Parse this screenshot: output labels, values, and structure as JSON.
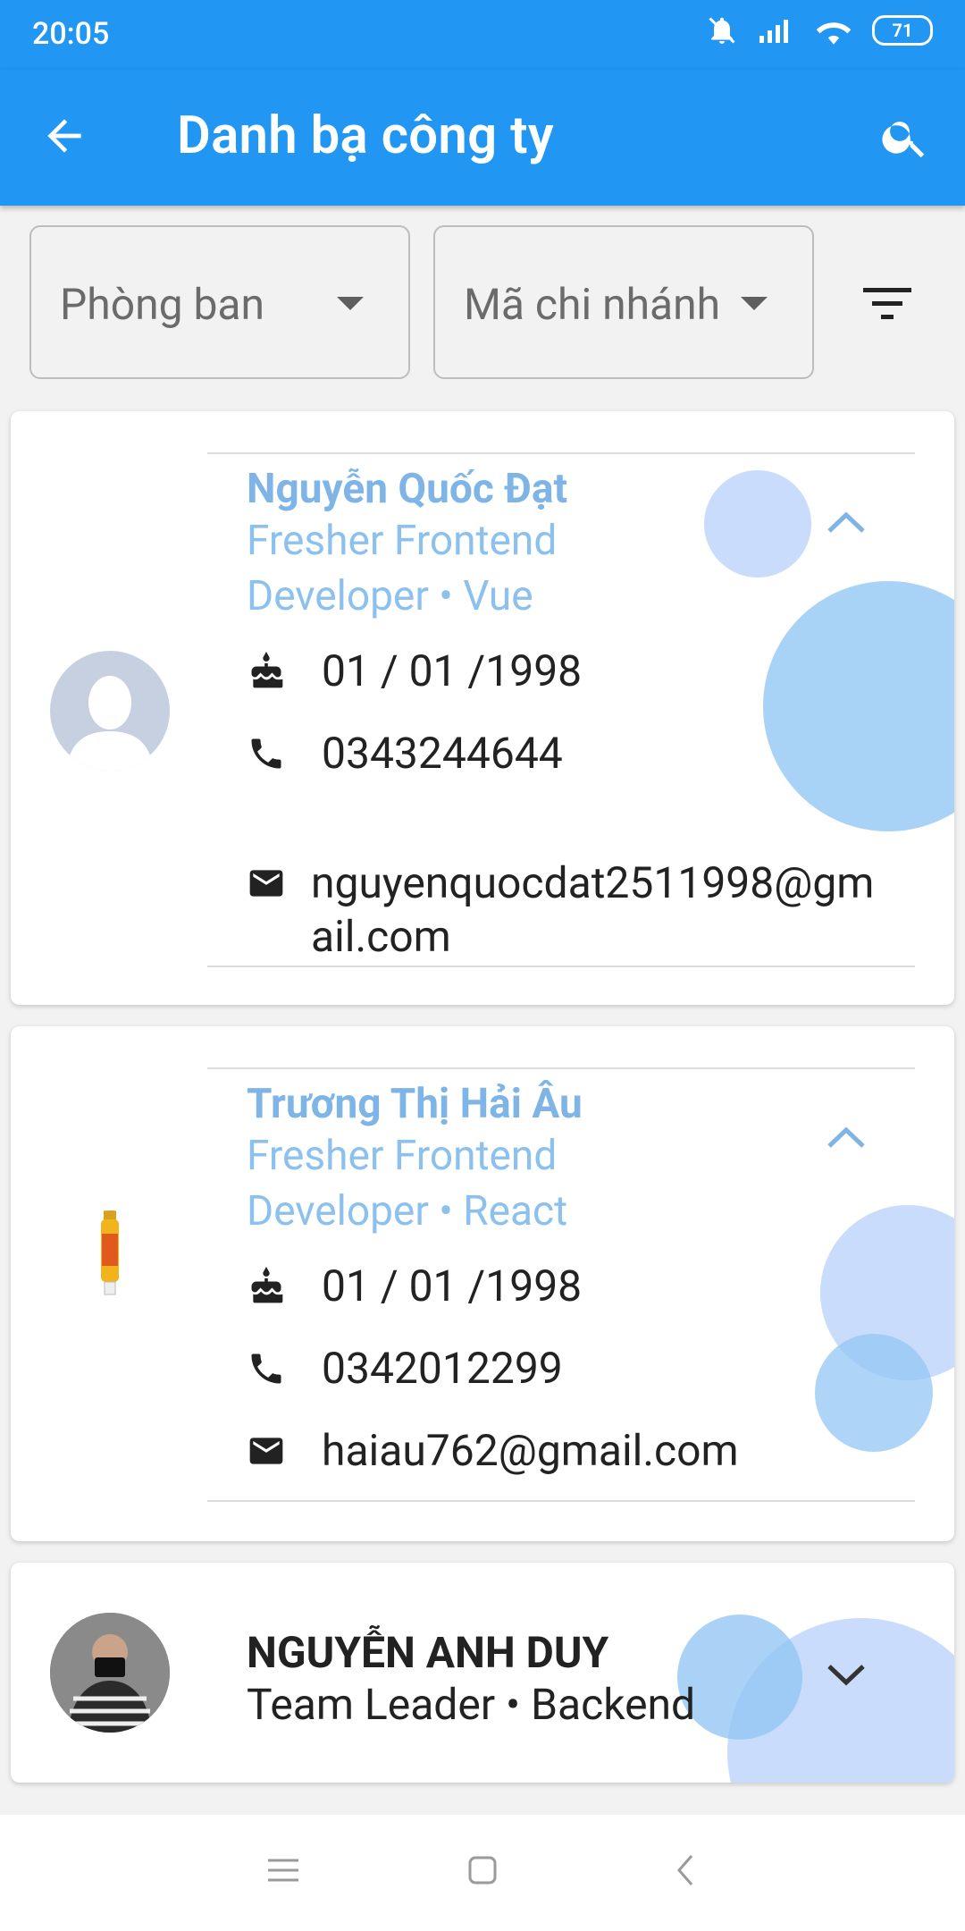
{
  "status_bar": {
    "time": "20:05",
    "battery": "71"
  },
  "app_bar": {
    "title": "Danh bạ công ty"
  },
  "filters": {
    "department_placeholder": "Phòng ban",
    "branch_placeholder": "Mã chi nhánh"
  },
  "contacts": [
    {
      "name": "Nguyễn Quốc Đạt",
      "role_line1": "Fresher Frontend",
      "role_line2": "Developer • Vue",
      "birthday": "01 / 01 /1998",
      "phone": "0343244644",
      "email_line1": "nguyenquocdat2511998@gm",
      "email_line2": "ail.com",
      "expanded": true
    },
    {
      "name": "Trương Thị Hải Âu",
      "role_line1": "Fresher Frontend",
      "role_line2": "Developer • React",
      "birthday": "01 / 01 /1998",
      "phone": "0342012299",
      "email": "haiau762@gmail.com",
      "expanded": true
    },
    {
      "name": "NGUYỄN ANH DUY",
      "role": "Team Leader • Backend",
      "expanded": false
    }
  ],
  "icons": {
    "back": "arrow-left-icon",
    "search": "search-icon",
    "sort": "filter-list-icon",
    "birthday": "cake-icon",
    "phone": "phone-icon",
    "email": "email-icon"
  },
  "colors": {
    "primary": "#2196F3",
    "name_accent": "#7fb5e6",
    "bubble_light": "#c9dcfb",
    "bubble_mid": "#a8d3f7"
  }
}
